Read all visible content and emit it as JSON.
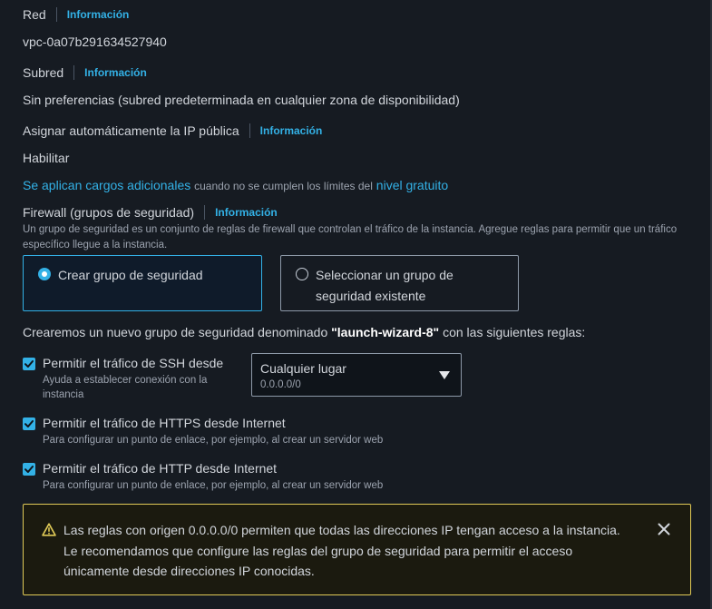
{
  "network": {
    "label": "Red",
    "info": "Información",
    "value": "vpc-0a07b291634527940"
  },
  "subnet": {
    "label": "Subred",
    "info": "Información",
    "value": "Sin preferencias (subred predeterminada en cualquier zona de disponibilidad)"
  },
  "public_ip": {
    "label": "Asignar automáticamente la IP pública",
    "info": "Información",
    "value": "Habilitar"
  },
  "charges": {
    "link1": "Se aplican cargos adicionales",
    "middle": "cuando no se cumplen los límites del",
    "link2": "nivel gratuito"
  },
  "firewall": {
    "label": "Firewall (grupos de seguridad)",
    "info": "Información",
    "description": "Un grupo de seguridad es un conjunto de reglas de firewall que controlan el tráfico de la instancia. Agregue reglas para permitir que un tráfico específico llegue a la instancia.",
    "options": [
      {
        "line1": "Crear grupo de seguridad",
        "line2": "",
        "selected": true
      },
      {
        "line1": "Seleccionar un grupo de",
        "line2": "seguridad existente",
        "selected": false
      }
    ]
  },
  "intro": {
    "before": "Crearemos un nuevo grupo de seguridad denominado ",
    "name": "\"launch-wizard-8\"",
    "after": " con las siguientes reglas:"
  },
  "rules": [
    {
      "title": "Permitir el tráfico de SSH desde",
      "desc": "Ayuda a establecer conexión con la instancia",
      "checked": true
    },
    {
      "title": "Permitir el tráfico de HTTPS desde Internet",
      "desc": "Para configurar un punto de enlace, por ejemplo, al crear un servidor web",
      "checked": true
    },
    {
      "title": "Permitir el tráfico de HTTP desde Internet",
      "desc": "Para configurar un punto de enlace, por ejemplo, al crear un servidor web",
      "checked": true
    }
  ],
  "ssh_source": {
    "value": "Cualquier lugar",
    "sub": "0.0.0.0/0"
  },
  "alert": {
    "text": "Las reglas con origen 0.0.0.0/0 permiten que todas las direcciones IP tengan acceso a la instancia. Le recomendamos que configure las reglas del grupo de seguridad para permitir el acceso únicamente desde direcciones IP conocidas."
  },
  "colors": {
    "background": "#161b22",
    "accent": "#33b1e6",
    "warning": "#e0ca57"
  }
}
